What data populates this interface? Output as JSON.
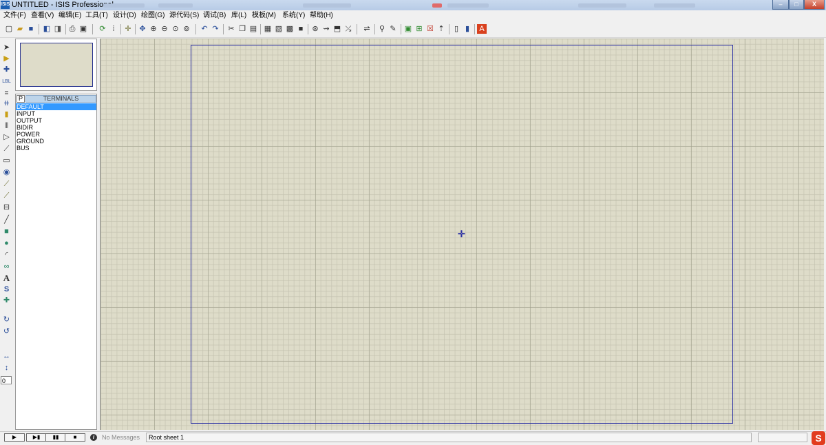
{
  "window": {
    "title": "UNTITLED - ISIS Professional",
    "app_icon": "ISIS",
    "controls": {
      "minimize": "–",
      "maximize": "□",
      "close": "X"
    }
  },
  "menu": {
    "items": [
      "文件(F)",
      "查看(V)",
      "编辑(E)",
      "工具(T)",
      "设计(D)",
      "绘图(G)",
      "源代码(S)",
      "调试(B)",
      "库(L)",
      "模板(M)",
      "系统(Y)",
      "帮助(H)"
    ]
  },
  "toolbar": {
    "icons": [
      "new-icon",
      "open-icon",
      "save-icon",
      "import-icon",
      "export-icon",
      "print-icon",
      "print-area-icon",
      "refresh-icon",
      "grid-icon",
      "origin-icon",
      "pan-icon",
      "zoom-in-icon",
      "zoom-out-icon",
      "zoom-all-icon",
      "zoom-area-icon",
      "undo-icon",
      "redo-icon",
      "cut-icon",
      "copy-icon",
      "paste-icon",
      "block-copy-icon",
      "block-move-icon",
      "block-rotate-icon",
      "block-delete-icon",
      "pick-device-icon",
      "make-device-icon",
      "package-icon",
      "decompose-icon",
      "wire-autorouter-icon",
      "search-icon",
      "property-tool-icon",
      "new-sheet-icon",
      "add-sheet-icon",
      "remove-sheet-icon",
      "exit-parent-icon",
      "bom-icon",
      "erc-icon",
      "netlist-icon",
      "ares-icon"
    ]
  },
  "left_tools": {
    "icons": [
      "selection-icon",
      "component-icon",
      "junction-icon",
      "wire-label-icon",
      "text-script-icon",
      "bus-icon",
      "subcircuit-icon",
      "terminal-icon",
      "pin-icon",
      "graph-icon",
      "tape-icon",
      "generator-icon",
      "voltage-probe-icon",
      "current-probe-icon",
      "virtual-instrument-icon",
      "line-icon",
      "box-icon",
      "circle-icon",
      "arc-icon",
      "path-icon",
      "text-icon",
      "symbol-icon",
      "marker-icon",
      "rotate-cw-icon",
      "rotate-ccw-icon",
      "mirror-horizontal-icon",
      "mirror-vertical-icon"
    ],
    "rotation_value": "0"
  },
  "device_panel": {
    "p_button": "P",
    "header": "TERMINALS",
    "items": [
      "DEFAULT",
      "INPUT",
      "OUTPUT",
      "BIDIR",
      "POWER",
      "GROUND",
      "BUS"
    ],
    "selected_index": 0
  },
  "statusbar": {
    "messages": "No Messages",
    "sheet": "Root sheet 1",
    "logo": "S"
  },
  "colors": {
    "canvas": "#dedcc9",
    "sheet_border": "#2a2fa3",
    "selection": "#3399ff"
  }
}
